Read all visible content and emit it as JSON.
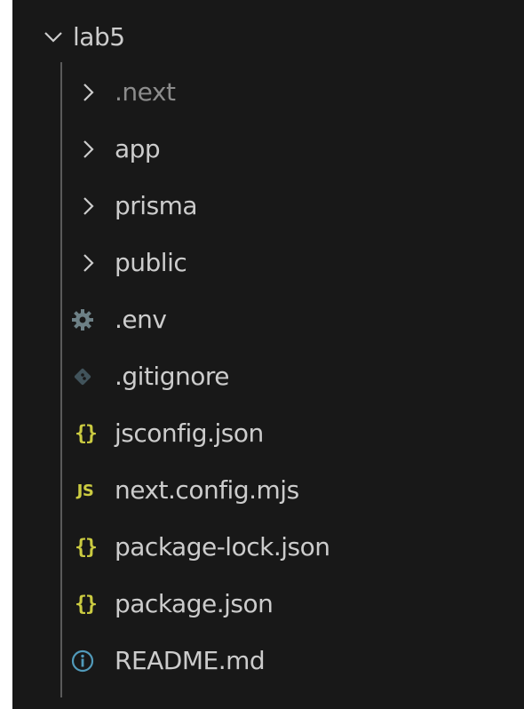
{
  "explorer": {
    "root": {
      "label": "lab5",
      "icon": "chevron-down-icon",
      "expanded": true
    },
    "items": [
      {
        "label": ".next",
        "icon": "chevron-right-icon",
        "kind": "folder",
        "dimmed": true
      },
      {
        "label": "app",
        "icon": "chevron-right-icon",
        "kind": "folder"
      },
      {
        "label": "prisma",
        "icon": "chevron-right-icon",
        "kind": "folder"
      },
      {
        "label": "public",
        "icon": "chevron-right-icon",
        "kind": "folder"
      },
      {
        "label": ".env",
        "icon": "gear-icon",
        "kind": "file"
      },
      {
        "label": ".gitignore",
        "icon": "git-diamond-icon",
        "kind": "file"
      },
      {
        "label": "jsconfig.json",
        "icon": "json-braces-icon",
        "icon_text": "{}",
        "kind": "file"
      },
      {
        "label": "next.config.mjs",
        "icon": "javascript-icon",
        "icon_text": "JS",
        "kind": "file"
      },
      {
        "label": "package-lock.json",
        "icon": "json-braces-icon",
        "icon_text": "{}",
        "kind": "file"
      },
      {
        "label": "package.json",
        "icon": "json-braces-icon",
        "icon_text": "{}",
        "kind": "file"
      },
      {
        "label": "README.md",
        "icon": "info-icon",
        "kind": "file"
      }
    ]
  },
  "colors": {
    "background": "#181818",
    "text": "#cccccc",
    "dimmed_text": "#8c8c8c",
    "json_icon": "#cbcb41",
    "js_icon": "#cbcb41",
    "info_icon": "#519aba",
    "gear_icon": "#6d8086",
    "git_icon": "#41535b",
    "indent_guide": "#5a5a5a"
  }
}
